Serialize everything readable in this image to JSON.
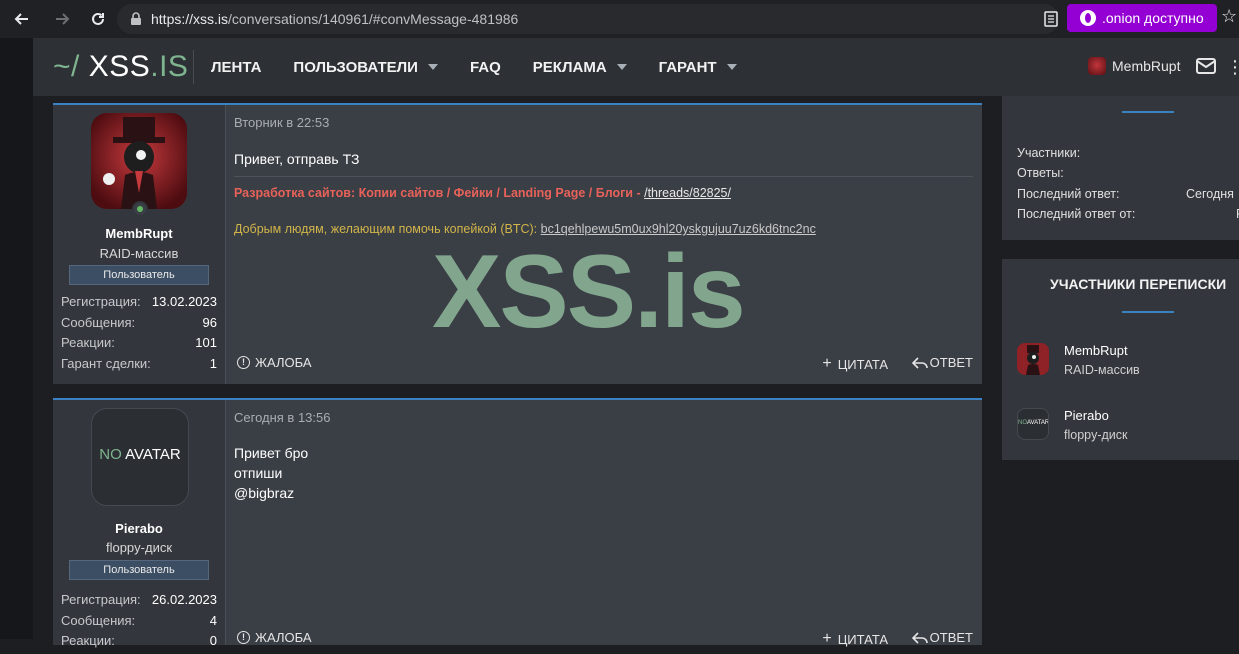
{
  "browser": {
    "url_host": "https://xss.is",
    "url_path": "/conversations/140961/#convMessage-481986",
    "onion_label": ".onion доступно"
  },
  "header": {
    "logo_prefix": "~/",
    "logo_main": "XSS",
    "logo_suffix": ".IS",
    "menu": [
      {
        "label": "ЛЕНТА"
      },
      {
        "label": "ПОЛЬЗОВАТЕЛИ"
      },
      {
        "label": "FAQ"
      },
      {
        "label": "РЕКЛАМА"
      },
      {
        "label": "ГАРАНТ"
      }
    ],
    "username": "MembRupt"
  },
  "watermark": "XSS.is",
  "messages": [
    {
      "username": "MembRupt",
      "user_title": "RAID-массив",
      "banner": "Пользователь",
      "stats": [
        {
          "k": "Регистрация:",
          "v": "13.02.2023"
        },
        {
          "k": "Сообщения:",
          "v": "96"
        },
        {
          "k": "Реакции:",
          "v": "101"
        },
        {
          "k": "Гарант сделки:",
          "v": "1"
        }
      ],
      "date": "Вторник в 22:53",
      "text": "Привет, отправь ТЗ",
      "sig1_text": "Разработка сайтов: Копии сайтов / Фейки / Landing Page / Блоги - ",
      "sig1_link": "/threads/82825/",
      "sig2_text": "Добрым людям, желающим помочь копейкой (BTC): ",
      "sig2_link": "bc1qehlpewu5m0ux9hl20yskgujuu7uz6kd6tnc2nc",
      "report": "ЖАЛОБА",
      "quote": "ЦИТАТА",
      "reply": "ОТВЕТ"
    },
    {
      "username": "Pierabo",
      "user_title": "floppy-диск",
      "banner": "Пользователь",
      "avatar_text_no": "NO",
      "avatar_text_avatar": "AVATAR",
      "stats": [
        {
          "k": "Регистрация:",
          "v": "26.02.2023"
        },
        {
          "k": "Сообщения:",
          "v": "4"
        },
        {
          "k": "Реакции:",
          "v": "0"
        }
      ],
      "date": "Сегодня в 13:56",
      "lines": [
        "Привет бро",
        "отпиши",
        "@bigbraz"
      ],
      "report": "ЖАЛОБА",
      "quote": "ЦИТАТА",
      "reply": "ОТВЕТ"
    }
  ],
  "sidebar": {
    "info": [
      {
        "k": "Участники:",
        "v": ""
      },
      {
        "k": "Ответы:",
        "v": ""
      },
      {
        "k": "Последний ответ:",
        "v": "Сегодня"
      },
      {
        "k": "Последний ответ от:",
        "v": "P"
      }
    ],
    "participants_title": "УЧАСТНИКИ ПЕРЕПИСКИ",
    "participants": [
      {
        "name": "MembRupt",
        "title": "RAID-массив"
      },
      {
        "name": "Pierabo",
        "title": "floppy-диск"
      }
    ]
  }
}
